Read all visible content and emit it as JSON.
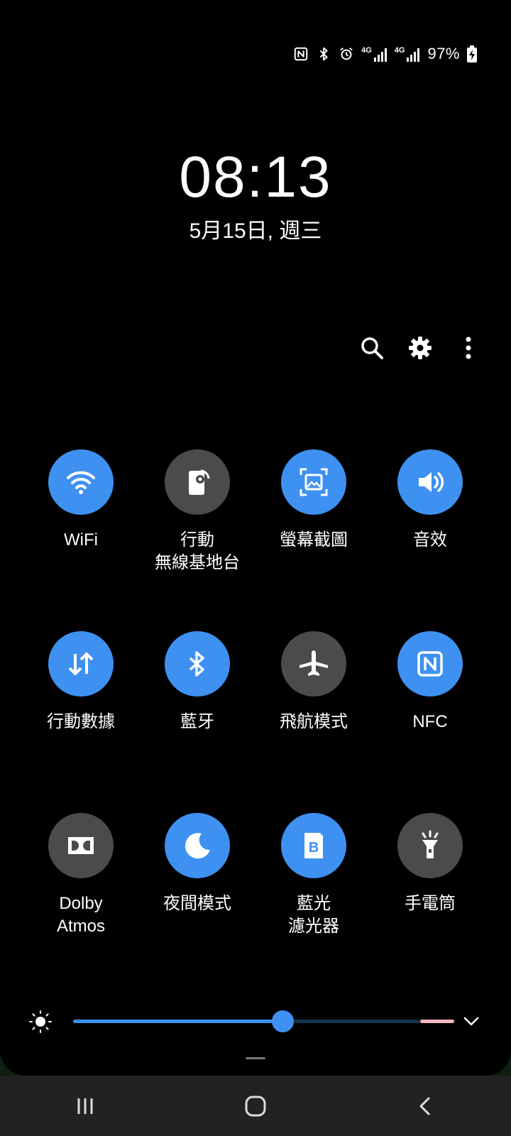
{
  "status": {
    "network1": "4G",
    "network2": "4G",
    "battery": "97%"
  },
  "lock": {
    "time": "08:13",
    "date": "5月15日, 週三"
  },
  "tiles": [
    {
      "label": "WiFi",
      "icon": "wifi-icon",
      "state": "on"
    },
    {
      "label": "行動\n無線基地台",
      "icon": "mobile-hotspot-icon",
      "state": "off"
    },
    {
      "label": "螢幕截圖",
      "icon": "screenshot-icon",
      "state": "on"
    },
    {
      "label": "音效",
      "icon": "sound-icon",
      "state": "on"
    },
    {
      "label": "行動數據",
      "icon": "mobile-data-icon",
      "state": "on"
    },
    {
      "label": "藍牙",
      "icon": "bluetooth-icon",
      "state": "on"
    },
    {
      "label": "飛航模式",
      "icon": "airplane-icon",
      "state": "off"
    },
    {
      "label": "NFC",
      "icon": "nfc-icon",
      "state": "on"
    },
    {
      "label": "Dolby\nAtmos",
      "icon": "dolby-icon",
      "state": "off"
    },
    {
      "label": "夜間模式",
      "icon": "night-mode-icon",
      "state": "on"
    },
    {
      "label": "藍光\n濾光器",
      "icon": "blue-light-filter-icon",
      "state": "on"
    },
    {
      "label": "手電筒",
      "icon": "flashlight-icon",
      "state": "off"
    }
  ],
  "brightness": {
    "level": 0.55
  },
  "colors": {
    "accent": "#3e91f1",
    "tile_off": "#4b4b4b",
    "panel": "#000000",
    "navbar": "#222222"
  }
}
